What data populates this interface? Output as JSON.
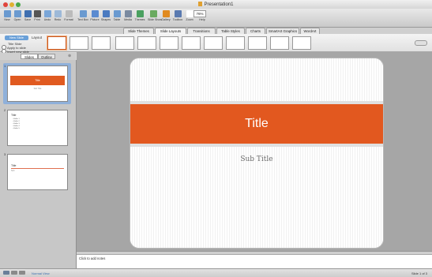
{
  "window": {
    "title": "Presentation1"
  },
  "toolbar": {
    "buttons": [
      {
        "label": "New",
        "icon": "new-document-icon",
        "color": "#6a9ad0"
      },
      {
        "label": "Open",
        "icon": "open-folder-icon",
        "color": "#6a9ad0"
      },
      {
        "label": "Save",
        "icon": "save-icon",
        "color": "#3f6fb0"
      },
      {
        "label": "Print",
        "icon": "print-icon",
        "color": "#555555"
      },
      {
        "label": "Undo",
        "icon": "undo-icon",
        "color": "#7aa6d8"
      },
      {
        "label": "Redo",
        "icon": "redo-icon",
        "color": "#9db9d8"
      },
      {
        "label": "Format",
        "icon": "format-brush-icon",
        "color": "#bbbbbb"
      },
      {
        "label": "Text Box",
        "icon": "textbox-icon",
        "color": "#6a9ad0"
      },
      {
        "label": "Picture",
        "icon": "picture-icon",
        "color": "#5a8ad0"
      },
      {
        "label": "Shapes",
        "icon": "shapes-icon",
        "color": "#4a7ac0"
      },
      {
        "label": "Table",
        "icon": "table-icon",
        "color": "#6a9ad0"
      },
      {
        "label": "Media",
        "icon": "media-icon",
        "color": "#7a8aa0"
      },
      {
        "label": "Themes",
        "icon": "themes-icon",
        "color": "#4aa060"
      },
      {
        "label": "Slide Show",
        "icon": "slideshow-icon",
        "color": "#6aaa60"
      },
      {
        "label": "Gallery",
        "icon": "gallery-icon",
        "color": "#e08a20"
      },
      {
        "label": "Toolbox",
        "icon": "toolbox-icon",
        "color": "#5a7ab0"
      },
      {
        "label": "Zoom",
        "icon": "zoom-icon",
        "color": "#ffffff"
      },
      {
        "label": "Help",
        "icon": "help-icon",
        "color": "#5a8ad0"
      }
    ],
    "zoom_value": "76%"
  },
  "ribbon": {
    "tabs": [
      "Slide Themes",
      "Slide Layouts",
      "Transitions",
      "Table Styles",
      "Charts",
      "SmartArt Graphics",
      "WordArt"
    ],
    "active_tab": "Slide Layouts",
    "new_slide_label": "New Slide",
    "layout_label": "Layout",
    "current_layout": "Title Slide",
    "apply_option": "Apply to slide",
    "insert_option": "Insert new slide"
  },
  "side_panel": {
    "tabs": [
      "Slides",
      "Outline"
    ],
    "active_tab": "Slides",
    "close_glyph": "⊗",
    "slides": [
      {
        "number": "1",
        "type": "title",
        "title": "Title",
        "subtitle": "Sub Title",
        "selected": true
      },
      {
        "number": "2",
        "type": "bullets",
        "title": "Title",
        "bullets": "• Bullet 1\n• Bullet 2\n• Bullet 3\n• Bullet 4\n• Bullet 5"
      },
      {
        "number": "3",
        "type": "title-only",
        "title": "Title",
        "subtitle": "Sub"
      }
    ]
  },
  "slide": {
    "title": "Title",
    "subtitle": "Sub Title",
    "accent": "#e2581f"
  },
  "notes": {
    "placeholder": "Click to add notes"
  },
  "status": {
    "view": "Normal View",
    "slide_count": "Slide 1 of 3"
  }
}
